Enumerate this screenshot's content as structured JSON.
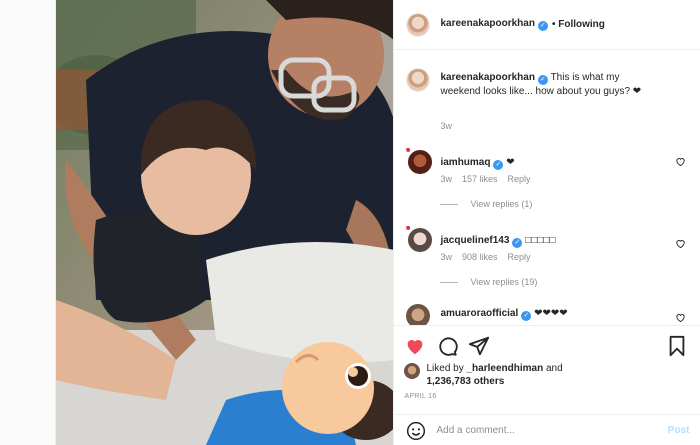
{
  "post": {
    "author": "kareenakapoorkhan",
    "follow_label": "• Following",
    "caption": "This is what my weekend looks like... how about you guys? ❤",
    "caption_time": "3w"
  },
  "comments": [
    {
      "user": "iamhumaq",
      "text": "❤",
      "time": "3w",
      "likes": "157 likes",
      "reply_label": "Reply",
      "view_replies": "View replies (1)"
    },
    {
      "user": "jacquelinef143",
      "text": "□□□□□",
      "time": "3w",
      "likes": "908 likes",
      "reply_label": "Reply",
      "view_replies": "View replies (19)"
    },
    {
      "user": "amuaroraofficial",
      "text": "❤❤❤❤"
    }
  ],
  "likes": {
    "prefix": "Liked by",
    "user": "_harleendhiman",
    "mid": "and",
    "count": "1,236,783 others"
  },
  "date": "APRIL 16",
  "add_comment": {
    "placeholder": "Add a comment...",
    "post_label": "Post"
  },
  "colors": {
    "like_red": "#ed4956",
    "verified_blue": "#3897f0",
    "post_button": "#b2dffc"
  },
  "icons": [
    "heart-filled-icon",
    "comment-icon",
    "share-icon",
    "bookmark-icon",
    "smiley-icon",
    "heart-outline-icon",
    "verified-badge-icon"
  ]
}
